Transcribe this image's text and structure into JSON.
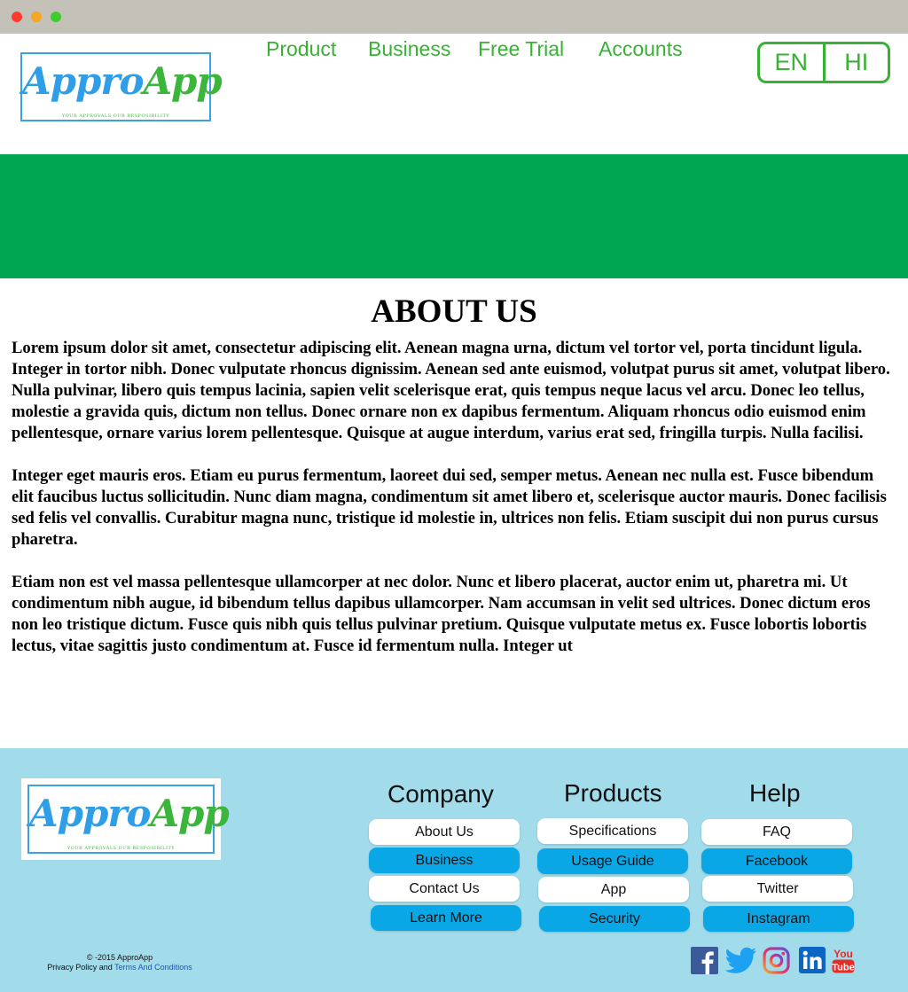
{
  "brand": {
    "name_part1": "Appro",
    "name_part2": "App",
    "tagline": "YOUR APPROVALS OUR RESPOSIBILITY"
  },
  "topnav": {
    "items": [
      {
        "label": "Product"
      },
      {
        "label": "Business"
      },
      {
        "label": "Free Trial"
      },
      {
        "label": "Accounts"
      }
    ]
  },
  "language": {
    "options": [
      {
        "label": "EN"
      },
      {
        "label": "HI"
      }
    ]
  },
  "colors": {
    "accent_green": "#37b233",
    "banner_green": "#00a651",
    "footer_bg": "#a2dbea",
    "button_blue": "#0aa7e6"
  },
  "about": {
    "title": "ABOUT US",
    "paragraphs": [
      "Lorem ipsum dolor sit amet, consectetur adipiscing elit. Aenean magna urna, dictum vel tortor vel, porta tincidunt ligula. Integer in tortor nibh. Donec vulputate rhoncus dignissim. Aenean sed ante euismod, volutpat purus sit amet, volutpat libero. Nulla pulvinar, libero quis tempus lacinia, sapien velit scelerisque erat, quis tempus neque lacus vel arcu. Donec leo tellus, molestie a gravida quis, dictum non tellus. Donec ornare non ex dapibus fermentum. Aliquam rhoncus odio euismod enim pellentesque, ornare varius lorem pellentesque. Quisque at augue interdum, varius erat sed, fringilla turpis. Nulla facilisi.",
      "Integer eget mauris eros. Etiam eu purus fermentum, laoreet dui sed, semper metus. Aenean nec nulla est. Fusce bibendum elit faucibus luctus sollicitudin. Nunc diam magna, condimentum sit amet libero et, scelerisque auctor mauris. Donec facilisis sed felis vel convallis. Curabitur magna nunc, tristique id molestie in, ultrices non felis. Etiam suscipit dui non purus cursus pharetra.",
      "Etiam non est vel massa pellentesque ullamcorper at nec dolor. Nunc et libero placerat, auctor enim ut, pharetra mi. Ut condimentum nibh augue, id bibendum tellus dapibus ullamcorper. Nam accumsan in velit sed ultrices. Donec dictum eros non leo tristique dictum. Fusce quis nibh quis tellus pulvinar pretium. Quisque vulputate metus ex. Fusce lobortis lobortis lectus, vitae sagittis justo condimentum at. Fusce id fermentum nulla. Integer ut"
    ]
  },
  "footer": {
    "columns": [
      {
        "heading": "Company",
        "links": [
          {
            "label": "About Us",
            "style": "white"
          },
          {
            "label": "Business",
            "style": "blue"
          },
          {
            "label": "Contact Us",
            "style": "white"
          },
          {
            "label": "Learn More",
            "style": "blue"
          }
        ]
      },
      {
        "heading": "Products",
        "links": [
          {
            "label": "Specifications",
            "style": "white"
          },
          {
            "label": "Usage Guide",
            "style": "blue"
          },
          {
            "label": "App",
            "style": "white"
          },
          {
            "label": "Security",
            "style": "blue"
          }
        ]
      },
      {
        "heading": "Help",
        "links": [
          {
            "label": "FAQ",
            "style": "white"
          },
          {
            "label": "Facebook",
            "style": "blue"
          },
          {
            "label": "Twitter",
            "style": "white"
          },
          {
            "label": "Instagram",
            "style": "blue"
          }
        ]
      }
    ],
    "copyright": "© -2015  ApproApp",
    "legal_prefix": "Privacy Policy and",
    "legal_link": "Terms And Conditions",
    "social": [
      {
        "icon": "facebook-icon"
      },
      {
        "icon": "twitter-icon"
      },
      {
        "icon": "instagram-icon"
      },
      {
        "icon": "linkedin-icon"
      },
      {
        "icon": "youtube-icon",
        "text_top": "You",
        "text_bottom": "Tube"
      }
    ]
  }
}
